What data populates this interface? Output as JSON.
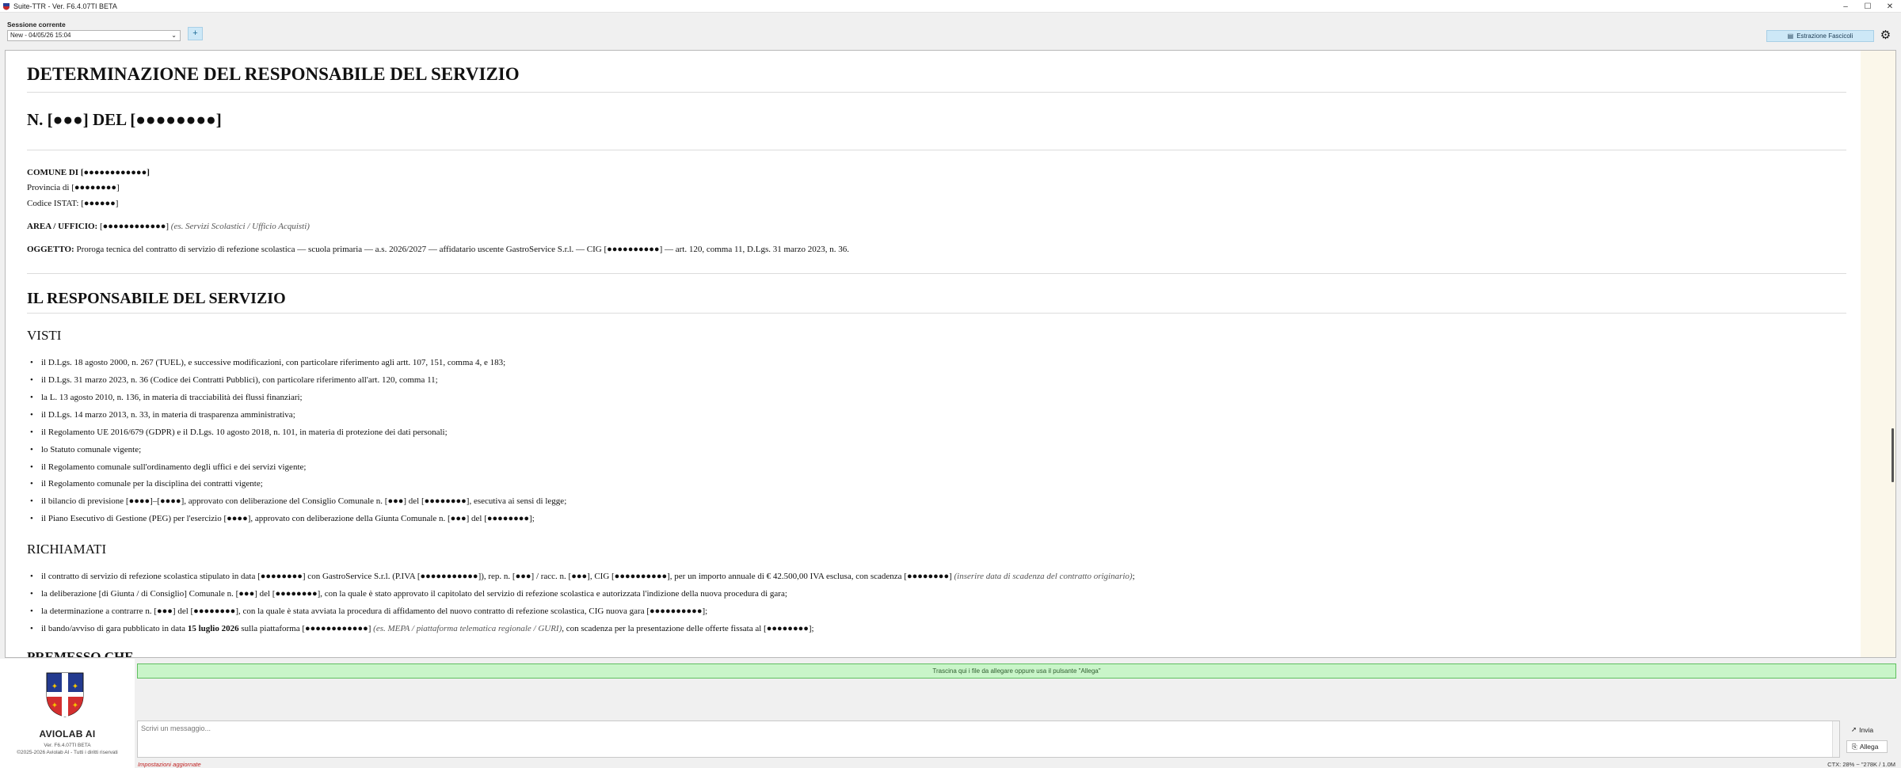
{
  "window": {
    "title": "Suite-TTR - Ver. F6.4.07TI BETA",
    "controls": [
      "–",
      "☐",
      "✕"
    ]
  },
  "session": {
    "label": "Sessione corrente",
    "selected": "New - 04/05/26 15:04",
    "add_label": "+",
    "extract_label": "Estrazione Fascicoli",
    "settings_icon": "gear-icon"
  },
  "document": {
    "title": "DETERMINAZIONE DEL RESPONSABILE DEL SERVIZIO",
    "number": "N. [●●●] DEL [●●●●●●●●]",
    "comune": "COMUNE DI [●●●●●●●●●●●●]",
    "provincia": "Provincia di [●●●●●●●●]",
    "istat": "Codice ISTAT: [●●●●●●]",
    "area_label": "AREA / UFFICIO:",
    "area_value": " [●●●●●●●●●●●●] ",
    "area_hint": "(es. Servizi Scolastici / Ufficio Acquisti)",
    "oggetto_label": "OGGETTO:",
    "oggetto_value": " Proroga tecnica del contratto di servizio di refezione scolastica — scuola primaria — a.s. 2026/2027 — affidatario uscente GastroService S.r.l. — CIG [●●●●●●●●●●] — art. 120, comma 11, D.Lgs. 31 marzo 2023, n. 36.",
    "section_heading": "IL RESPONSABILE DEL SERVIZIO",
    "visti_heading": "VISTI",
    "visti": [
      "il D.Lgs. 18 agosto 2000, n. 267 (TUEL), e successive modificazioni, con particolare riferimento agli artt. 107, 151, comma 4, e 183;",
      "il D.Lgs. 31 marzo 2023, n. 36 (Codice dei Contratti Pubblici), con particolare riferimento all'art. 120, comma 11;",
      "la L. 13 agosto 2010, n. 136, in materia di tracciabilità dei flussi finanziari;",
      "il D.Lgs. 14 marzo 2013, n. 33, in materia di trasparenza amministrativa;",
      "il Regolamento UE 2016/679 (GDPR) e il D.Lgs. 10 agosto 2018, n. 101, in materia di protezione dei dati personali;",
      "lo Statuto comunale vigente;",
      "il Regolamento comunale sull'ordinamento degli uffici e dei servizi vigente;",
      "il Regolamento comunale per la disciplina dei contratti vigente;",
      "il bilancio di previsione [●●●●]–[●●●●], approvato con deliberazione del Consiglio Comunale n. [●●●] del [●●●●●●●●], esecutiva ai sensi di legge;",
      "il Piano Esecutivo di Gestione (PEG) per l'esercizio [●●●●], approvato con deliberazione della Giunta Comunale n. [●●●] del [●●●●●●●●];"
    ],
    "richiamati_heading": "RICHIAMATI",
    "richiamati": [
      {
        "text": "il contratto di servizio di refezione scolastica stipulato in data [●●●●●●●●] con GastroService S.r.l. (P.IVA [●●●●●●●●●●●]), rep. n. [●●●] / racc. n. [●●●], CIG [●●●●●●●●●●], per un importo annuale di € 42.500,00 IVA esclusa, con scadenza [●●●●●●●●] ",
        "hint": "(inserire data di scadenza del contratto originario)",
        "tail": ";"
      },
      {
        "text": "la deliberazione [di Giunta / di Consiglio] Comunale n. [●●●] del [●●●●●●●●], con la quale è stato approvato il capitolato del servizio di refezione scolastica e autorizzata l'indizione della nuova procedura di gara;",
        "hint": "",
        "tail": ""
      },
      {
        "text": "la determinazione a contrarre n. [●●●] del [●●●●●●●●], con la quale è stata avviata la procedura di affidamento del nuovo contratto di refezione scolastica, CIG nuova gara [●●●●●●●●●●];",
        "hint": "",
        "tail": ""
      }
    ],
    "bando_pre": "il bando/avviso di gara pubblicato in data ",
    "bando_bold": "15 luglio 2026",
    "bando_mid": " sulla piattaforma [●●●●●●●●●●●●] ",
    "bando_hint": "(es. MEPA / piattaforma telematica regionale / GURI)",
    "bando_post": ", con scadenza per la presentazione delle offerte fissata al [●●●●●●●●];",
    "premesso_heading": "PREMESSO CHE"
  },
  "brand": {
    "name": "AVIOLAB AI",
    "version": "Ver. F6.4.07TI BETA",
    "copyright": "©2025-2026 Aviolab AI - Tutti i diritti riservati"
  },
  "dropzone": "Trascina qui i file da allegare oppure usa il pulsante \"Allega\"",
  "composer": {
    "placeholder": "Scrivi un messaggio...",
    "send_label": "Invia",
    "attach_label": "Allega"
  },
  "footer": {
    "settings_link": "Impostazioni aggiornate",
    "context": "CTX: 28% ~ \"278K / 1.0M"
  },
  "colors": {
    "accent_blue": "#cde8f7",
    "drop_green": "#c9f5c9",
    "warning_red": "#c02020"
  }
}
